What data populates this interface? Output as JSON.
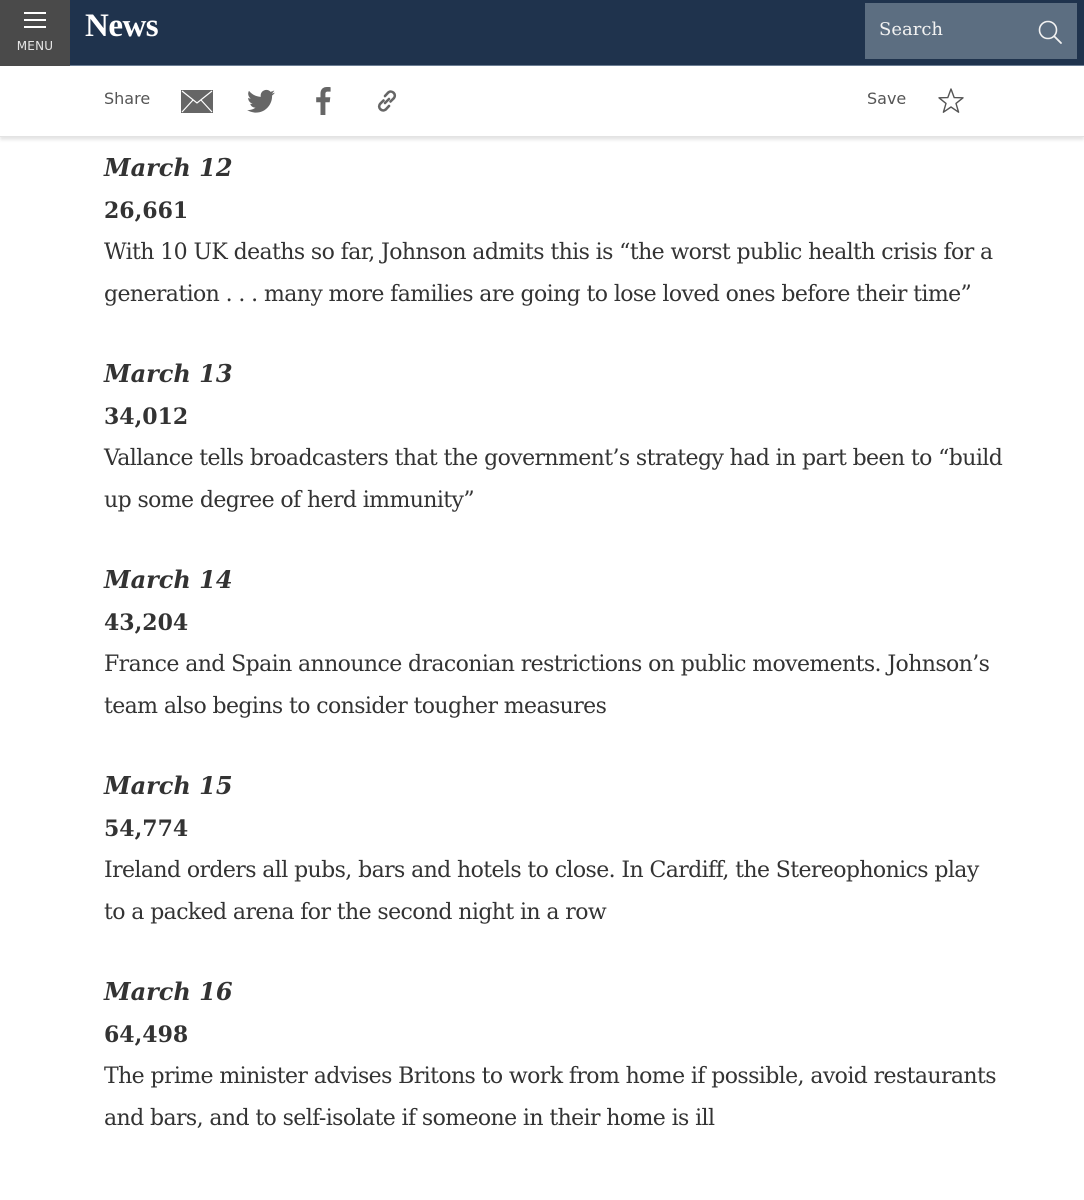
{
  "header": {
    "menu_label": "MENU",
    "brand": "News",
    "search_placeholder": "Search"
  },
  "sharebar": {
    "share_label": "Share",
    "icons": [
      "mail-icon",
      "twitter-icon",
      "facebook-icon",
      "link-icon"
    ],
    "save_label": "Save",
    "save_icon": "star-icon"
  },
  "colors": {
    "header_bg": "#1f334d",
    "menu_bg": "#4a4a4a",
    "search_bg": "#5c6e81",
    "text": "#333333",
    "icon_gray": "#666666"
  },
  "entries": [
    {
      "date": "March 12",
      "count": "26,661",
      "text": "With 10 UK deaths so far, Johnson admits this is “the worst public health crisis for a generation . . . many more families are going to lose loved ones before their time”"
    },
    {
      "date": "March 13",
      "count": "34,012",
      "text": "Vallance tells broadcasters that the government’s strategy had in part been to “build up some degree of herd immunity”"
    },
    {
      "date": "March 14",
      "count": "43,204",
      "text": "France and Spain announce draconian restrictions on public movements. Johnson’s team also begins to consider tougher measures"
    },
    {
      "date": "March 15",
      "count": "54,774",
      "text": "Ireland orders all pubs, bars and hotels to close. In Cardiff, the Stereophonics play to a packed arena for the second night in a row"
    },
    {
      "date": "March 16",
      "count": "64,498",
      "text": "The prime minister advises Britons to work from home if possible, avoid restaurants and bars, and to self-isolate if someone in their home is ill"
    }
  ]
}
